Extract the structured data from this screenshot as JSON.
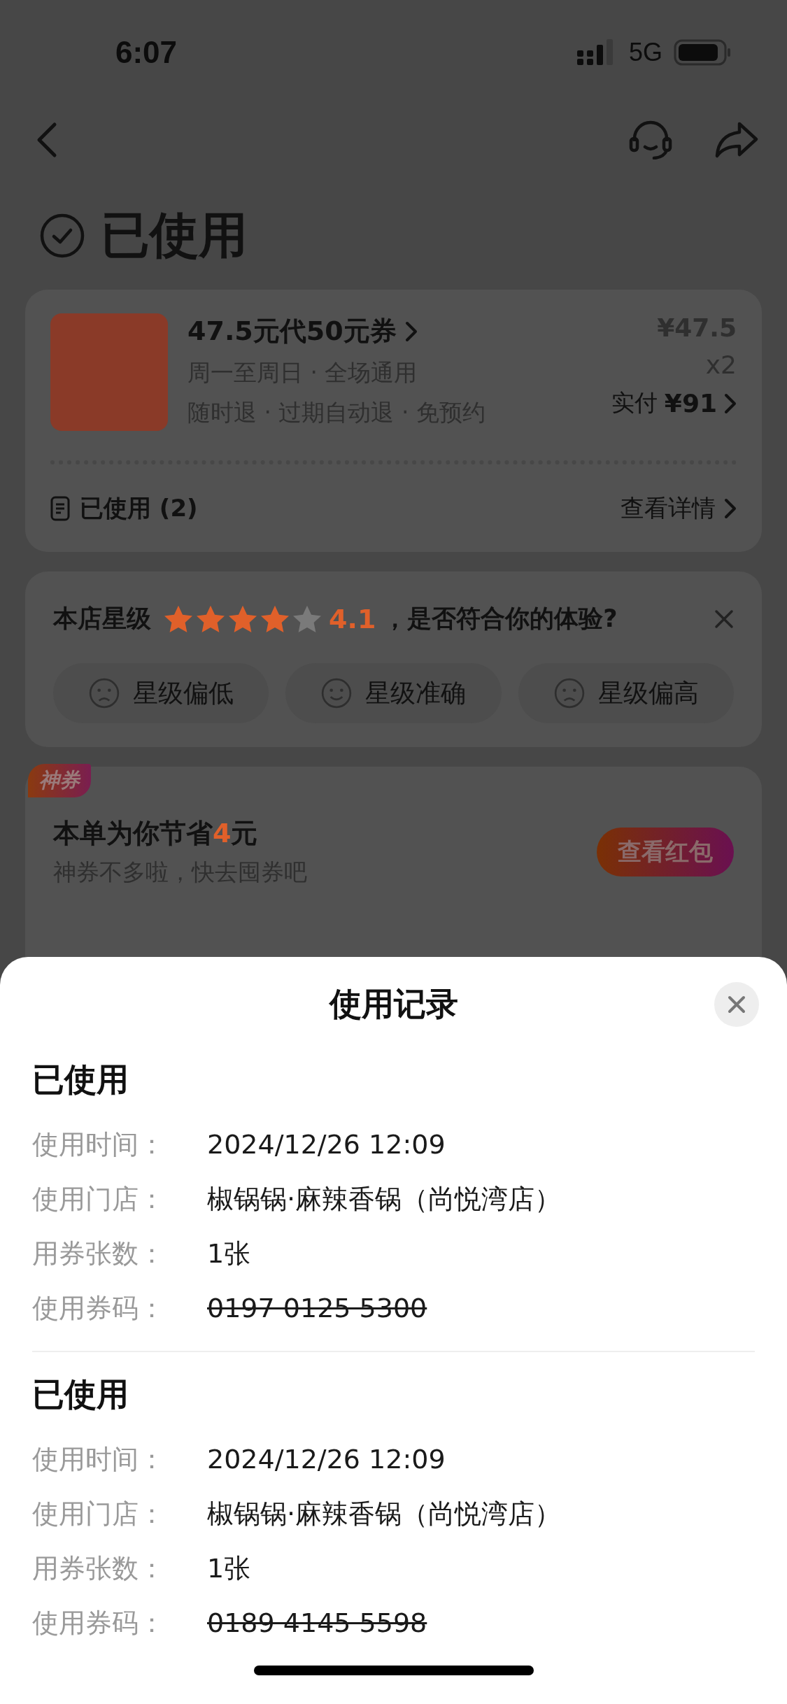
{
  "status_bar": {
    "time": "6:07",
    "network": "5G"
  },
  "header": {
    "status": "已使用"
  },
  "order_card": {
    "title": "47.5元代50元券",
    "validity": "周一至周日 · 全场通用",
    "terms": "随时退 · 过期自动退 · 免预约",
    "unit_price": "¥47.5",
    "quantity": "x2",
    "paid_label": "实付",
    "paid_amount": "¥91",
    "usage_label": "已使用 (2)",
    "details_link": "查看详情"
  },
  "rating_card": {
    "label": "本店星级",
    "stars": 4,
    "score": "4.1",
    "question": "，是否符合你的体验?",
    "options": [
      {
        "label": "星级偏低",
        "kind": "frown"
      },
      {
        "label": "星级准确",
        "kind": "smile"
      },
      {
        "label": "星级偏高",
        "kind": "frown"
      }
    ]
  },
  "promo_card": {
    "badge": "神券",
    "savings_before": "本单为你节省",
    "savings_amount": "4",
    "savings_after": "元",
    "subtitle": "神券不多啦，快去囤券吧",
    "button": "查看红包"
  },
  "usage_sheet": {
    "title": "使用记录",
    "records": [
      {
        "status": "已使用",
        "fields": [
          {
            "label": "使用时间：",
            "value": "2024/12/26 12:09",
            "kind": "text"
          },
          {
            "label": "使用门店：",
            "value": "椒锅锅·麻辣香锅（尚悦湾店）",
            "kind": "text"
          },
          {
            "label": "用券张数：",
            "value": "1张",
            "kind": "text"
          },
          {
            "label": "使用券码：",
            "value": "0197 0125 5300",
            "kind": "code"
          }
        ]
      },
      {
        "status": "已使用",
        "fields": [
          {
            "label": "使用时间：",
            "value": "2024/12/26 12:09",
            "kind": "text"
          },
          {
            "label": "使用门店：",
            "value": "椒锅锅·麻辣香锅（尚悦湾店）",
            "kind": "text"
          },
          {
            "label": "用券张数：",
            "value": "1张",
            "kind": "text"
          },
          {
            "label": "使用券码：",
            "value": "0189 4145 5598",
            "kind": "code"
          }
        ]
      }
    ]
  }
}
